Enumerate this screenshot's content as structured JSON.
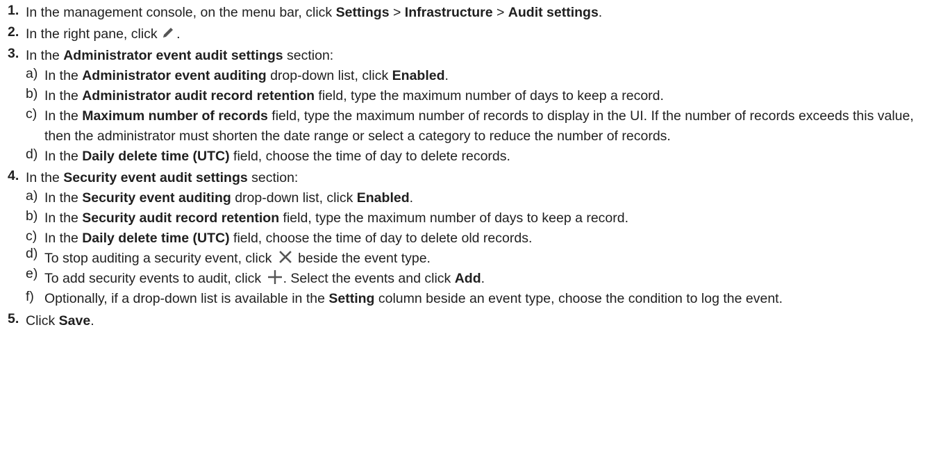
{
  "steps": [
    {
      "num": "1.",
      "parts": [
        "In the management console, on the menu bar, click ",
        "Settings",
        " > ",
        "Infrastructure",
        " > ",
        "Audit settings",
        "."
      ]
    },
    {
      "num": "2.",
      "before": "In the right pane, click ",
      "icon": "pencil-icon",
      "after": "."
    },
    {
      "num": "3.",
      "intro": [
        "In the ",
        "Administrator event audit settings",
        " section:"
      ],
      "subs": [
        {
          "letter": "a)",
          "parts": [
            "In the ",
            "Administrator event auditing",
            " drop-down list, click ",
            "Enabled",
            "."
          ]
        },
        {
          "letter": "b)",
          "parts": [
            "In the ",
            "Administrator audit record retention",
            " field, type the maximum number of days to keep a record."
          ]
        },
        {
          "letter": "c)",
          "parts": [
            "In the ",
            "Maximum number of records",
            " field, type the maximum number of records to display in the UI. If the number of records exceeds this value, then the administrator must shorten the date range or select a category to reduce the number of records."
          ]
        },
        {
          "letter": "d)",
          "parts": [
            "In the ",
            "Daily delete time (UTC)",
            " field, choose the time of day to delete records."
          ]
        }
      ]
    },
    {
      "num": "4.",
      "intro": [
        "In the ",
        "Security event audit settings",
        " section:"
      ],
      "subs": [
        {
          "letter": "a)",
          "parts": [
            "In the ",
            "Security event auditing",
            " drop-down list, click ",
            "Enabled",
            "."
          ]
        },
        {
          "letter": "b)",
          "parts": [
            "In the ",
            "Security audit record retention",
            " field, type the maximum number of days to keep a record."
          ]
        },
        {
          "letter": "c)",
          "parts": [
            "In the ",
            "Daily delete time (UTC)",
            " field, choose the time of day to delete old records."
          ]
        },
        {
          "letter": "d)",
          "before": "To stop auditing a security event, click ",
          "icon": "close-icon",
          "after": " beside the event type."
        },
        {
          "letter": "e)",
          "before": "To add security events to audit, click ",
          "icon": "plus-icon",
          "after": ". Select the events and click ",
          "bold_after": "Add",
          "tail": "."
        },
        {
          "letter": "f)",
          "parts": [
            "Optionally, if a drop-down list is available in the ",
            "Setting",
            " column beside an event type, choose the condition to log the event."
          ]
        }
      ]
    },
    {
      "num": "5.",
      "parts": [
        "Click ",
        "Save",
        "."
      ]
    }
  ],
  "colors": {
    "text": "#1f1f1f",
    "icon": "#555555"
  }
}
